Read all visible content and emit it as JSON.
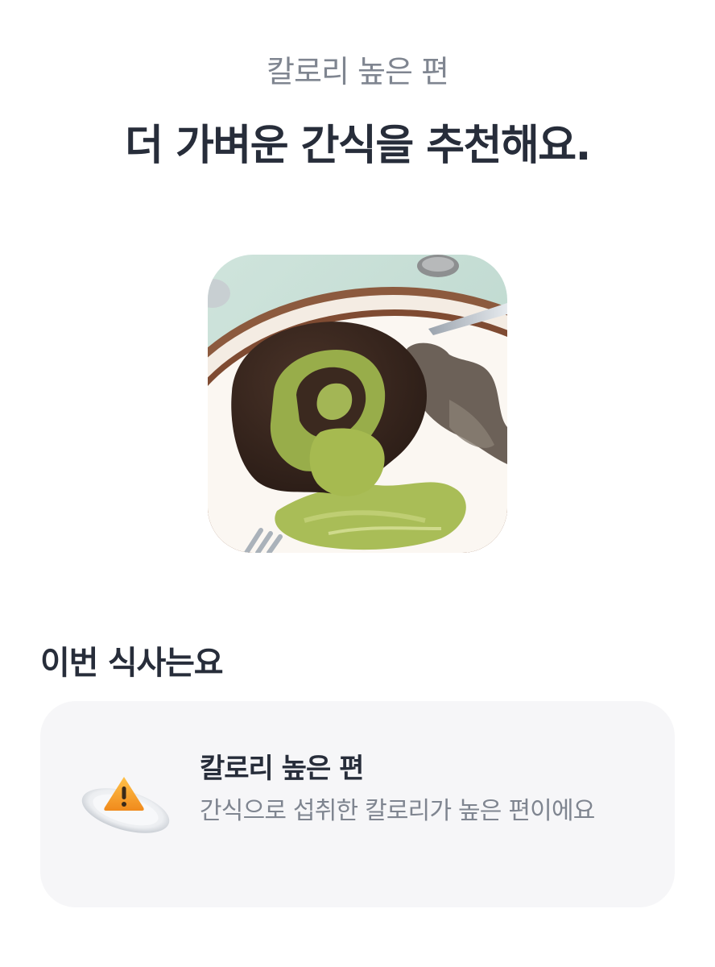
{
  "header": {
    "subtitle": "칼로리 높은 편",
    "headline": "더 가벼운 간식을 추천해요."
  },
  "photo": {
    "subject": "matcha chocolate roll cake on a plate"
  },
  "section": {
    "title": "이번 식사는요"
  },
  "card": {
    "icon": "warning-plate-icon",
    "title": "칼로리 높은 편",
    "description": "간식으로 섭취한 칼로리가 높은 편이에요"
  },
  "colors": {
    "heading": "#272d3a",
    "muted": "#7f8590",
    "card_bg": "#f6f6f8",
    "warning": "#f5a623"
  }
}
